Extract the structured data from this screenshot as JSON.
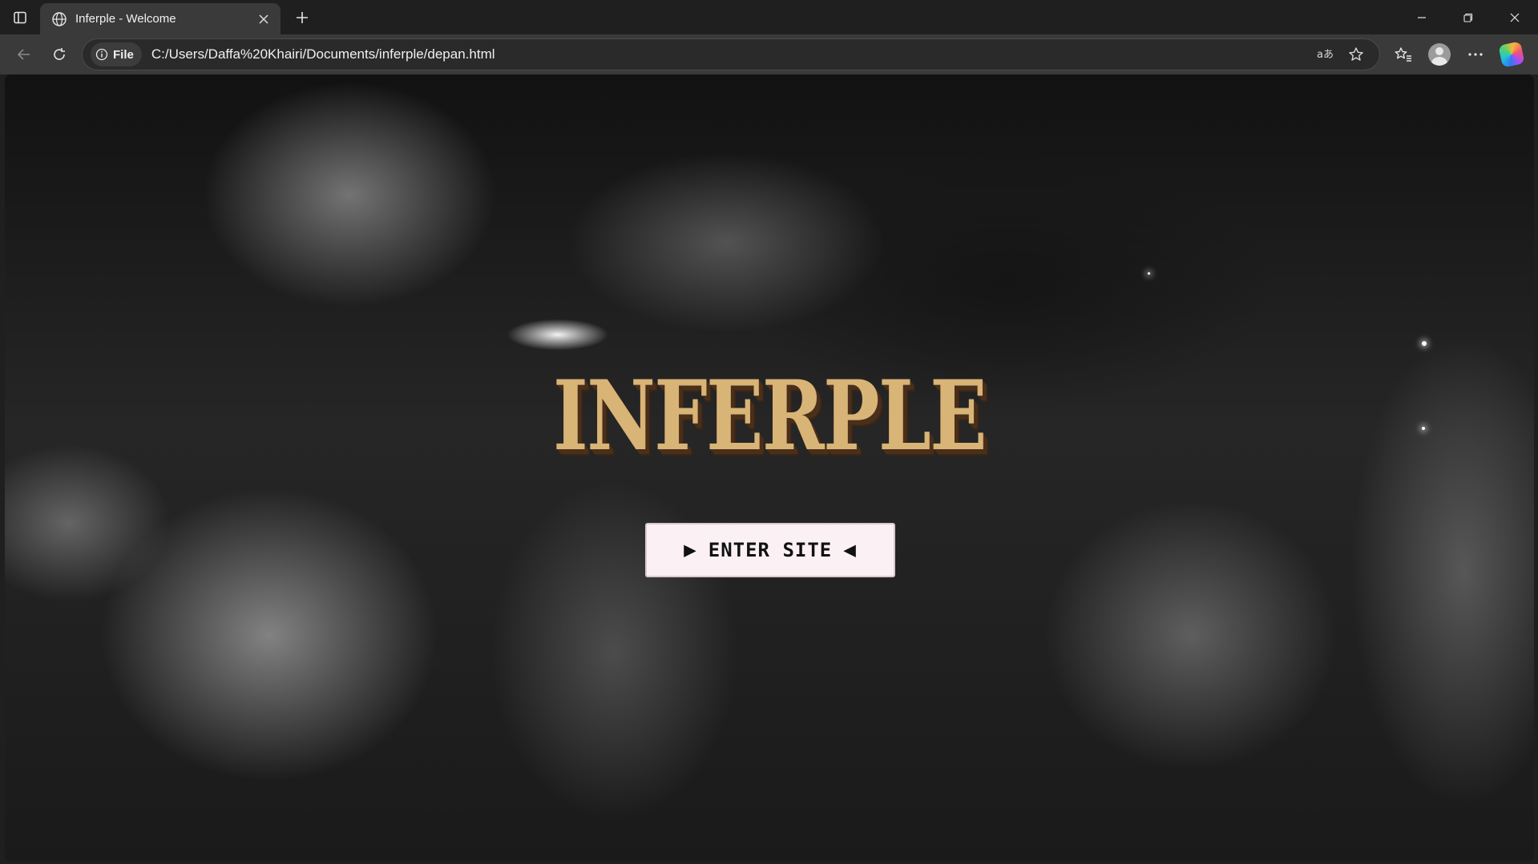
{
  "browser": {
    "tab": {
      "title": "Inferple - Welcome"
    },
    "address_bar": {
      "site_info_label": "File",
      "url": "C:/Users/Daffa%20Khairi/Documents/inferple/depan.html"
    },
    "icons": {
      "tab_actions": "sidebar-icon",
      "tab_favicon": "globe-icon",
      "tab_close": "close-icon",
      "new_tab": "plus-icon",
      "back": "arrow-left-icon",
      "refresh": "refresh-icon",
      "site_info": "info-icon",
      "read_aloud": "read-aloud-icon",
      "favorite": "star-icon",
      "favorites": "favorites-icon",
      "profile": "profile-icon",
      "menu": "more-icon",
      "copilot": "copilot-icon"
    }
  },
  "page": {
    "logo_text": "INFERPLE",
    "enter_button": {
      "left_arrow": "▶",
      "label": "ENTER SITE",
      "right_arrow": "◀"
    },
    "colors": {
      "logo_fill": "#d9b477",
      "logo_shadow": "#4a2f1a",
      "button_bg": "#fbf1f4"
    }
  }
}
